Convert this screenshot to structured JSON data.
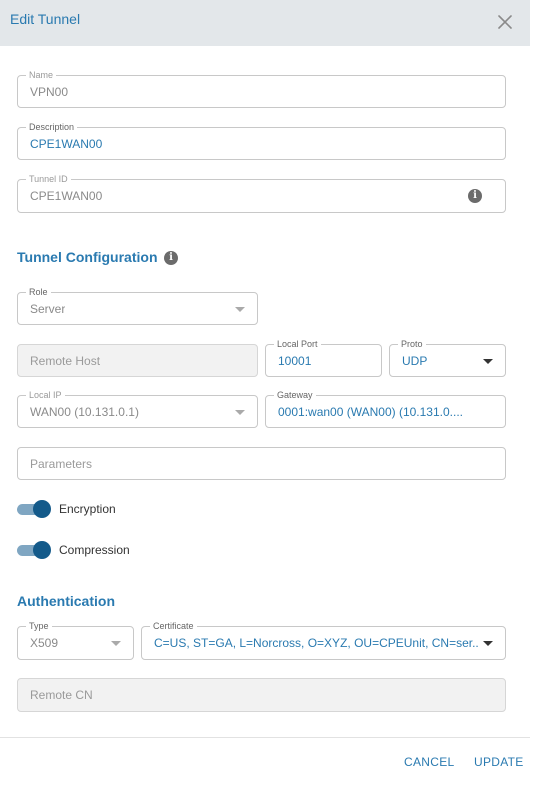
{
  "dialog": {
    "title": "Edit Tunnel",
    "close_icon": "close-icon"
  },
  "name": {
    "label": "Name",
    "value": "VPN00"
  },
  "description": {
    "label": "Description",
    "value": "CPE1WAN00"
  },
  "tunnel_id": {
    "label": "Tunnel ID",
    "value": "CPE1WAN00",
    "info_icon": "i"
  },
  "tunnel_config": {
    "title": "Tunnel Configuration",
    "info_icon": "i"
  },
  "role": {
    "label": "Role",
    "value": "Server"
  },
  "remote_host": {
    "placeholder": "Remote Host"
  },
  "local_port": {
    "label": "Local Port",
    "value": "10001"
  },
  "proto": {
    "label": "Proto",
    "value": "UDP"
  },
  "local_ip": {
    "label": "Local IP",
    "value": "WAN00 (10.131.0.1)"
  },
  "gateway": {
    "label": "Gateway",
    "value": "0001:wan00 (WAN00) (10.131.0...."
  },
  "parameters": {
    "placeholder": "Parameters"
  },
  "encryption": {
    "label": "Encryption",
    "on": true
  },
  "compression": {
    "label": "Compression",
    "on": true
  },
  "authentication": {
    "title": "Authentication"
  },
  "auth_type": {
    "label": "Type",
    "value": "X509"
  },
  "certificate": {
    "label": "Certificate",
    "value": "C=US, ST=GA, L=Norcross, O=XYZ, OU=CPEUnit, CN=ser..."
  },
  "remote_cn": {
    "placeholder": "Remote CN"
  },
  "actions": {
    "cancel": "CANCEL",
    "update": "UPDATE"
  },
  "colors": {
    "accent": "#2a7ab0",
    "header_bg": "#e3e7ea",
    "toggle_knob": "#145a8a"
  }
}
